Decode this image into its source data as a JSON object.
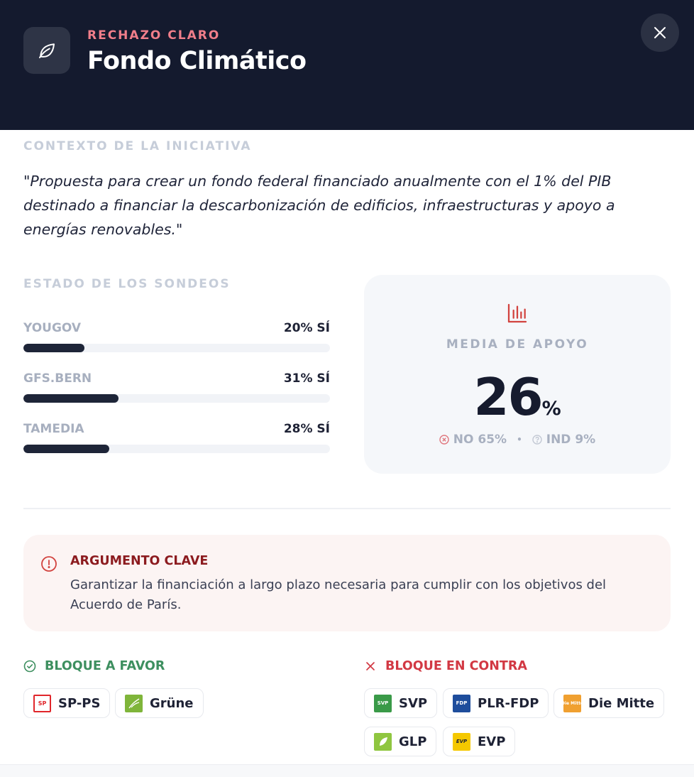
{
  "header": {
    "kicker": "RECHAZO CLARO",
    "title": "Fondo Climático",
    "icon": "leaf-icon",
    "close_icon": "close-icon"
  },
  "context": {
    "label": "CONTEXTO DE LA INICIATIVA",
    "quote": "\"Propuesta para crear un fondo federal financiado anualmente con el 1% del PIB destinado a financiar la descarbonización de edificios, infraestructuras y apoyo a energías renovables.\""
  },
  "polls": {
    "label": "ESTADO DE LOS SONDEOS",
    "items": [
      {
        "name": "YOUGOV",
        "value_label": "20% SÍ",
        "fill_percent": 20
      },
      {
        "name": "GFS.BERN",
        "value_label": "31% SÍ",
        "fill_percent": 31
      },
      {
        "name": "TAMEDIA",
        "value_label": "28% SÍ",
        "fill_percent": 28
      }
    ]
  },
  "average": {
    "icon": "bar-chart-icon",
    "label": "MEDIA DE APOYO",
    "value": "26",
    "unit": "%",
    "no_label": "NO 65%",
    "ind_label": "IND 9%",
    "separator": "•"
  },
  "key_argument": {
    "icon": "alert-circle-icon",
    "title": "ARGUMENTO CLAVE",
    "text": "Garantizar la financiación a largo plazo necesaria para cumplir con los objetivos del Acuerdo de París."
  },
  "bloc_favor": {
    "icon": "check-circle-icon",
    "title": "BLOQUE A FAVOR",
    "color": "#3d8f5f",
    "parties": [
      {
        "name": "SP-PS",
        "logo_text": "SP",
        "logo_color": "#e0262b"
      },
      {
        "name": "Grüne",
        "logo_text": "",
        "logo_color": "#7fb53a"
      }
    ]
  },
  "bloc_contra": {
    "icon": "x-icon",
    "title": "BLOQUE EN CONTRA",
    "color": "#d23843",
    "parties": [
      {
        "name": "SVP",
        "logo_text": "SVP",
        "logo_color": "#3a9a48"
      },
      {
        "name": "PLR-FDP",
        "logo_text": "FDP",
        "logo_color": "#1e4d9c"
      },
      {
        "name": "Die Mitte",
        "logo_text": "Die Mitte",
        "logo_color": "#f0a030"
      },
      {
        "name": "GLP",
        "logo_text": "",
        "logo_color": "#8fc640"
      },
      {
        "name": "EVP",
        "logo_text": "EVP",
        "logo_color": "#f5c800"
      }
    ]
  }
}
